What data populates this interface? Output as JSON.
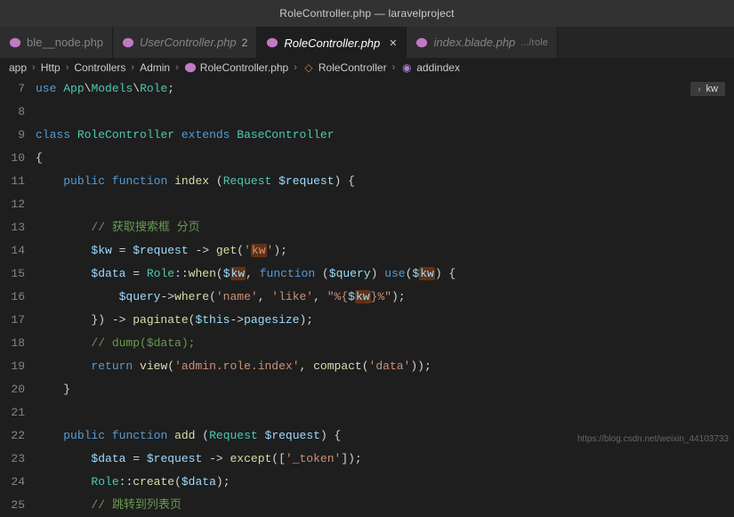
{
  "title": "RoleController.php — laravelproject",
  "tabs": [
    {
      "label": "ble__node.php",
      "dot": false,
      "num": "",
      "close": false,
      "active": false
    },
    {
      "label": "UserController.php",
      "dot": true,
      "num": "2",
      "close": false,
      "active": false
    },
    {
      "label": "RoleController.php",
      "dot": true,
      "num": "",
      "close": true,
      "active": true
    },
    {
      "label": "index.blade.php",
      "dot": true,
      "num": "",
      "hint": ".../role",
      "close": false,
      "active": false
    }
  ],
  "breadcrumbs": [
    "app",
    "Http",
    "Controllers",
    "Admin",
    "RoleController.php",
    "RoleController",
    "addindex"
  ],
  "searchBadge": "kw",
  "lines": [
    {
      "n": 7,
      "html": "<span class='kw'>use</span> <span class='cls'>App</span>\\<span class='cls'>Models</span>\\<span class='cls'>Role</span>;"
    },
    {
      "n": 8,
      "html": ""
    },
    {
      "n": 9,
      "html": "<span class='kw'>class</span> <span class='cls'>RoleController</span> <span class='kw'>extends</span> <span class='cls'>BaseController</span>"
    },
    {
      "n": 10,
      "html": "{"
    },
    {
      "n": 11,
      "html": "    <span class='kw'>public</span> <span class='kw'>function</span> <span class='fn'>index</span> (<span class='cls'>Request</span> <span class='vr'>$request</span>) {"
    },
    {
      "n": 12,
      "html": ""
    },
    {
      "n": 13,
      "html": "        <span class='cm'>// 获取搜索框 分页</span>"
    },
    {
      "n": 14,
      "html": "        <span class='vr'>$kw</span> = <span class='vr'>$request</span> -&gt; <span class='fn'>get</span>(<span class='str'>'<span class='hl'>kw</span>'</span>);"
    },
    {
      "n": 15,
      "html": "        <span class='vr'>$data</span> = <span class='cls'>Role</span>::<span class='fn'>when</span>(<span class='vr'>$<span class='hl'>kw</span></span>, <span class='kw'>function</span> (<span class='vr'>$query</span>) <span class='kw'>use</span>(<span class='vr'>$<span class='hl'>kw</span></span>) {"
    },
    {
      "n": 16,
      "html": "            <span class='vr'>$query</span>-&gt;<span class='fn'>where</span>(<span class='str'>'name'</span>, <span class='str'>'like'</span>, <span class='str'>\"%{<span class='vr'>$<span class='hl'>kw</span></span>}%\"</span>);"
    },
    {
      "n": 17,
      "html": "        }) -&gt; <span class='fn'>paginate</span>(<span class='vr'>$this</span>-&gt;<span class='vr'>pagesize</span>);"
    },
    {
      "n": 18,
      "html": "        <span class='cm'>// dump($data);</span>"
    },
    {
      "n": 19,
      "html": "        <span class='kw'>return</span> <span class='fn'>view</span>(<span class='str'>'admin.role.index'</span>, <span class='fn'>compact</span>(<span class='str'>'data'</span>));"
    },
    {
      "n": 20,
      "html": "    }"
    },
    {
      "n": 21,
      "html": ""
    },
    {
      "n": 22,
      "html": "    <span class='kw'>public</span> <span class='kw'>function</span> <span class='fn'>add</span> (<span class='cls'>Request</span> <span class='vr'>$request</span>) {"
    },
    {
      "n": 23,
      "html": "        <span class='vr'>$data</span> = <span class='vr'>$request</span> -&gt; <span class='fn'>except</span>([<span class='str'>'_token'</span>]);"
    },
    {
      "n": 24,
      "html": "        <span class='cls'>Role</span>::<span class='fn'>create</span>(<span class='vr'>$data</span>);"
    },
    {
      "n": 25,
      "html": "        <span class='cm'>// 跳转到列表页</span>"
    }
  ],
  "watermark": "https://blog.csdn.net/weixin_44103733"
}
